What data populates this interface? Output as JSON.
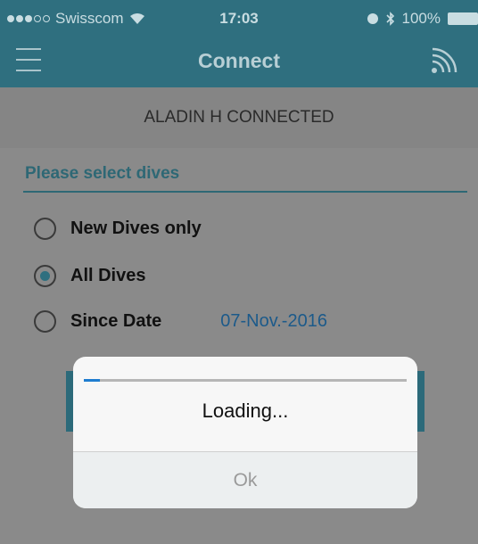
{
  "status_bar": {
    "carrier": "Swisscom",
    "time": "17:03",
    "battery": "100%"
  },
  "nav": {
    "title": "Connect"
  },
  "banner": {
    "text": "ALADIN H CONNECTED"
  },
  "select_dives": {
    "title": "Please select dives",
    "options": [
      {
        "label": "New Dives only",
        "checked": false
      },
      {
        "label": "All Dives",
        "checked": true
      },
      {
        "label": "Since Date",
        "checked": false
      }
    ],
    "since_date_value": "07-Nov.-2016"
  },
  "dialog": {
    "progress": 0.05,
    "message": "Loading...",
    "ok_label": "Ok"
  },
  "colors": {
    "accent": "#2f6f7f",
    "progress": "#1f7dd0",
    "date_link": "#1c5a8a"
  }
}
